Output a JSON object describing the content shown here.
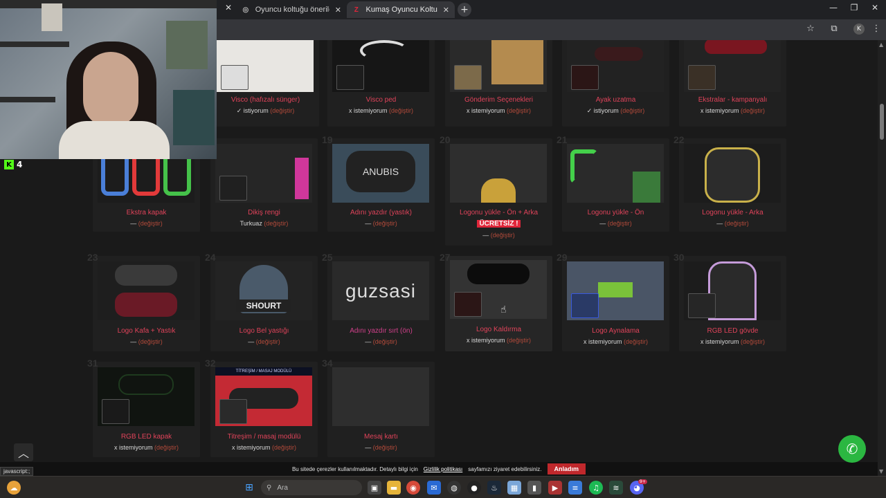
{
  "browser": {
    "tabs": [
      {
        "title": "Oyuncu koltuğu önerileri",
        "close": "✕"
      },
      {
        "title": "Kumaş Oyuncu Koltuğu - Zio Ga",
        "close": "✕"
      }
    ],
    "newtab": "+",
    "status_url": "javascript:;"
  },
  "overlay": {
    "kick_count": "4",
    "kick_logo": "K"
  },
  "cards": [
    {
      "title": "Visco (hafızalı sünger)",
      "value_prefix": "✓ istiyorum",
      "change": "(değiştir)"
    },
    {
      "title": "Visco ped",
      "value_prefix": "x istemiyorum",
      "change": "(değiştir)"
    },
    {
      "title": "Gönderim Seçenekleri",
      "value_prefix": "x istemiyorum",
      "change": "(değiştir)"
    },
    {
      "title": "Ayak uzatma",
      "value_prefix": "✓ istiyorum",
      "change": "(değiştir)"
    },
    {
      "title": "Ekstralar - kampanyalı",
      "value_prefix": "x istemiyorum",
      "change": "(değiştir)"
    },
    {
      "num": "",
      "title": "Ekstra kapak",
      "value_prefix": "—",
      "change": "(değiştir)"
    },
    {
      "num": "",
      "title": "Dikiş rengi",
      "value_prefix": "Turkuaz",
      "change": "(değiştir)"
    },
    {
      "num": "19",
      "title": "Adını yazdır (yastık)",
      "value_prefix": "—",
      "change": "(değiştir)"
    },
    {
      "num": "20",
      "title": "Logonu yükle - Ön + Arka",
      "badge": "ÜCRETSİZ !",
      "value_prefix": "—",
      "change": "(değiştir)"
    },
    {
      "num": "21",
      "title": "Logonu yükle - Ön",
      "value_prefix": "—",
      "change": "(değiştir)"
    },
    {
      "num": "22",
      "title": "Logonu yükle - Arka",
      "value_prefix": "—",
      "change": "(değiştir)"
    },
    {
      "num": "23",
      "title": "Logo Kafa + Yastık",
      "value_prefix": "—",
      "change": "(değiştir)"
    },
    {
      "num": "24",
      "title": "Logo Bel yastığı",
      "value_prefix": "—",
      "change": "(değiştir)"
    },
    {
      "num": "25",
      "title": "Adını yazdır sırt (ön)",
      "value_prefix": "—",
      "change": "(değiştir)",
      "thumb_text": "guzsasi"
    },
    {
      "num": "27",
      "title": "Logo Kaldırma",
      "value_prefix": "x istemiyorum",
      "change": "(değiştir)"
    },
    {
      "num": "29",
      "title": "Logo Aynalama",
      "value_prefix": "x istemiyorum",
      "change": "(değiştir)"
    },
    {
      "num": "30",
      "title": "RGB LED gövde",
      "value_prefix": "x istemiyorum",
      "change": "(değiştir)"
    },
    {
      "num": "31",
      "title": "RGB LED kapak",
      "value_prefix": "x istemiyorum",
      "change": "(değiştir)"
    },
    {
      "num": "32",
      "title": "Titreşim / masaj modülü",
      "value_prefix": "x istemiyorum",
      "change": "(değiştir)",
      "thumb_text": "TİTREŞİM / MASAJ MODÜLÜ"
    },
    {
      "num": "34",
      "title": "Mesaj kartı",
      "value_prefix": "—",
      "change": "(değiştir)"
    }
  ],
  "cookie": {
    "text_before": "Bu sitede çerezler kullanılmaktadır. Detaylı bilgi için",
    "link": "Gizlilik politikası",
    "text_after": "sayfamızı ziyaret edebilirsiniz.",
    "button": "Anladım"
  },
  "taskbar": {
    "search_placeholder": "Ara",
    "discord_badge": "9+"
  },
  "colors": {
    "accent": "#e0435a",
    "change_link": "#b24a3a",
    "whatsapp": "#2bb741",
    "cookie_button": "#c0282c"
  }
}
